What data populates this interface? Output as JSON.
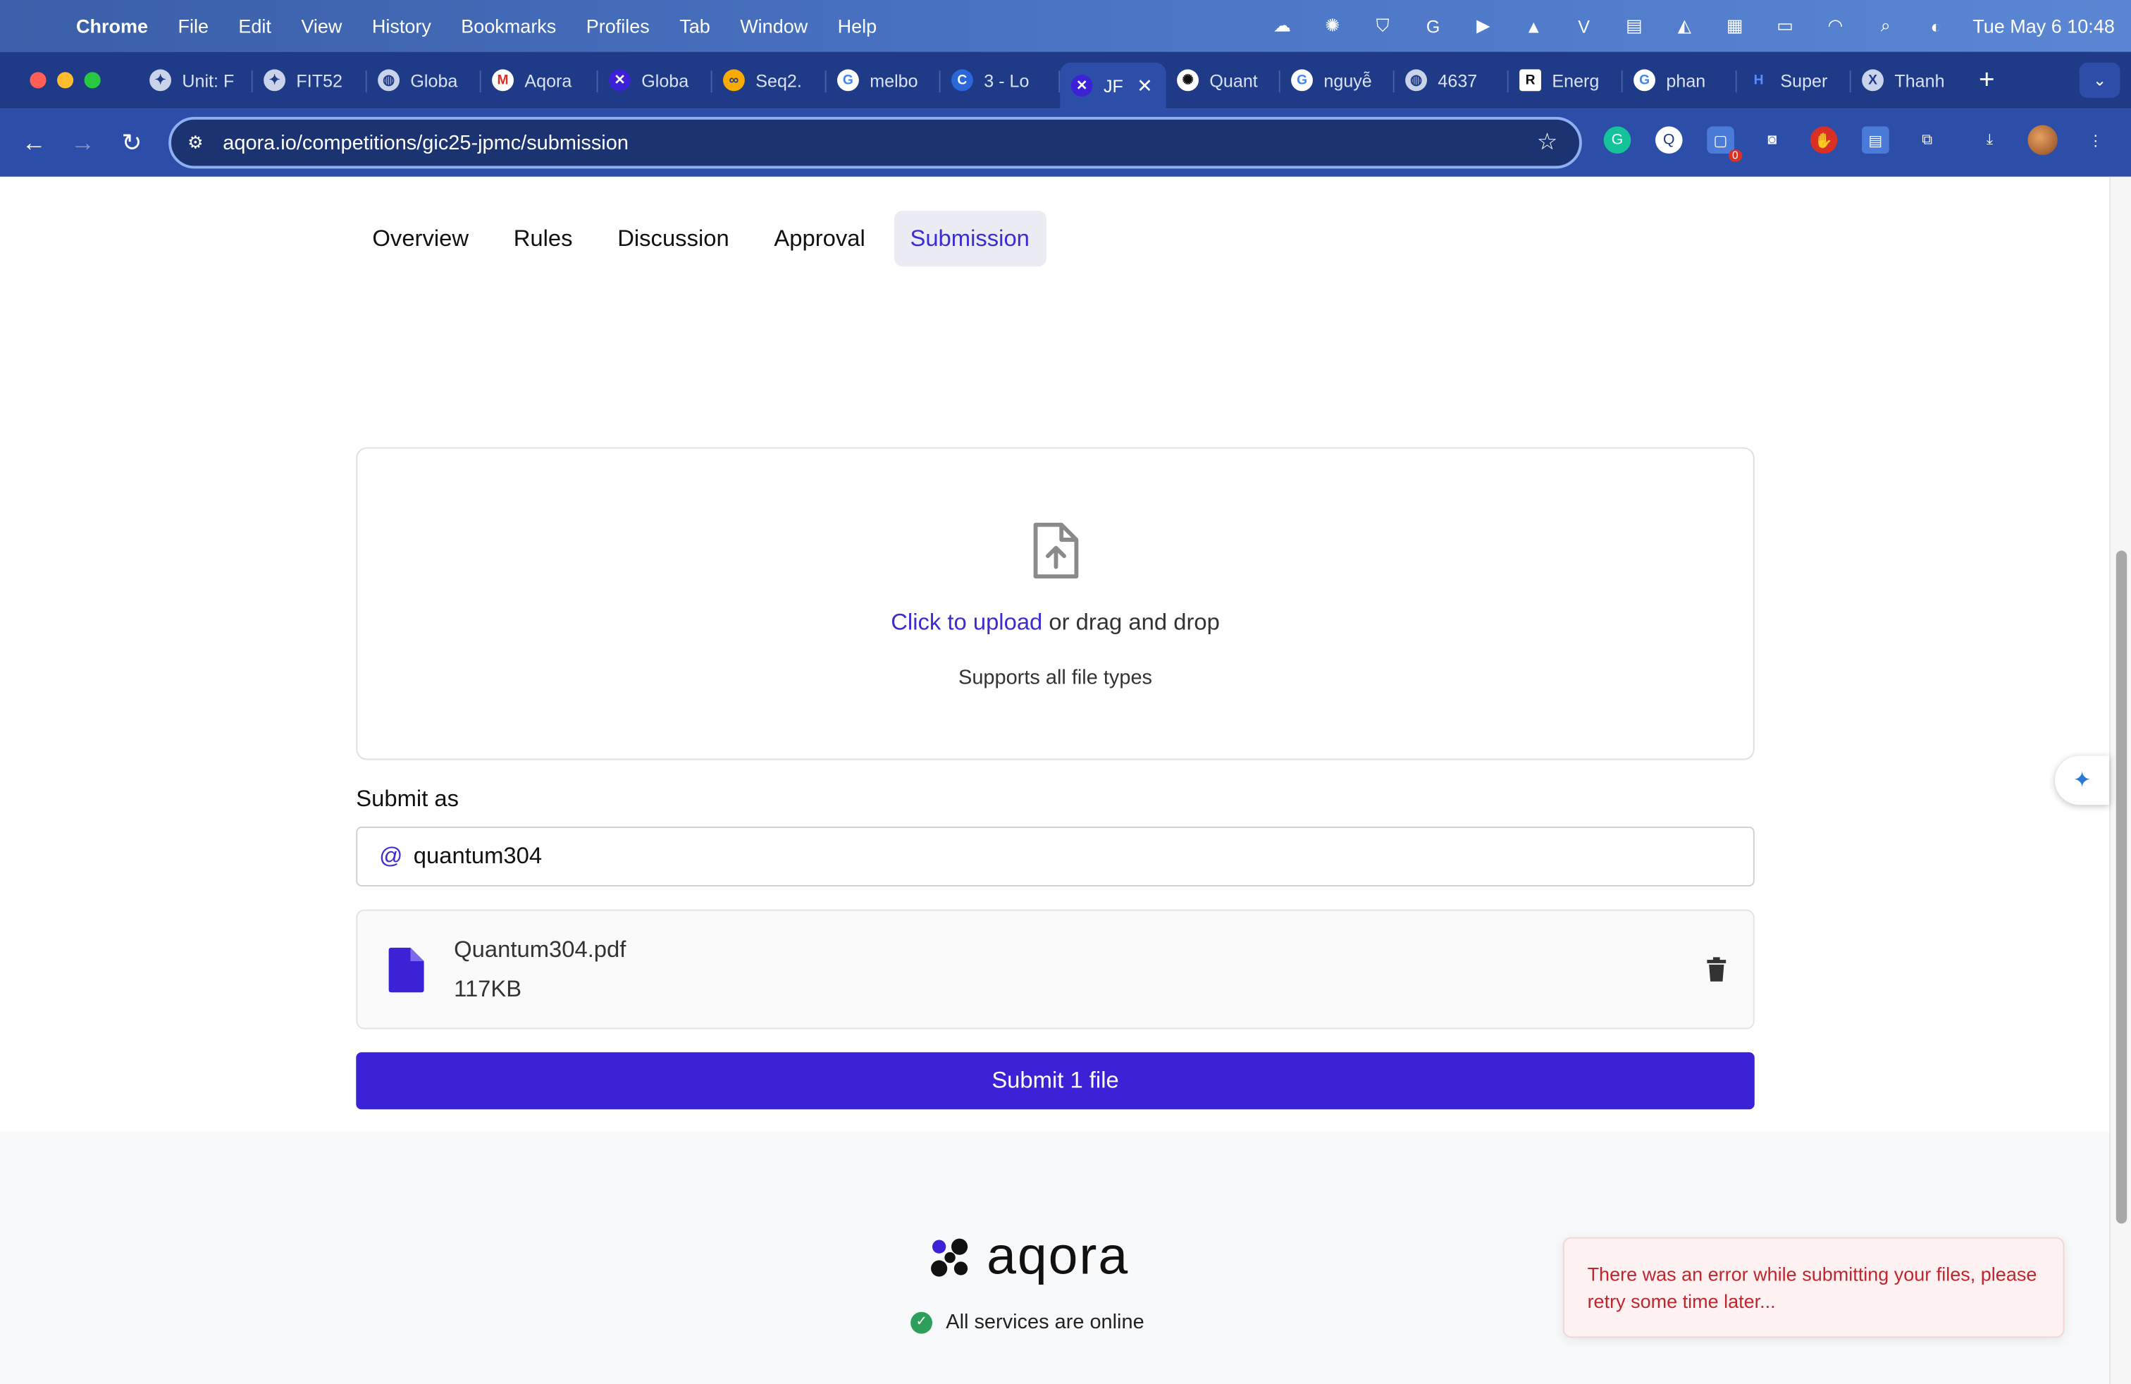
{
  "menubar": {
    "app_name": "Chrome",
    "items": [
      "File",
      "Edit",
      "View",
      "History",
      "Bookmarks",
      "Profiles",
      "Tab",
      "Window",
      "Help"
    ],
    "clock": "Tue May 6  10:48"
  },
  "tabs": [
    {
      "label": "Unit: F",
      "icon": "globe-icon"
    },
    {
      "label": "FIT52",
      "icon": "globe-icon"
    },
    {
      "label": "Globa",
      "icon": "globe-icon"
    },
    {
      "label": "Aqora",
      "icon": "gmail-icon"
    },
    {
      "label": "Globa",
      "icon": "aqora-icon"
    },
    {
      "label": "Seq2.",
      "icon": "colab-icon"
    },
    {
      "label": "melbo",
      "icon": "google-icon"
    },
    {
      "label": "3 - Lo",
      "icon": "globe-icon"
    },
    {
      "label": "JF",
      "icon": "aqora-icon",
      "active": true
    },
    {
      "label": "Quant",
      "icon": "chatgpt-icon"
    },
    {
      "label": "nguyễ",
      "icon": "google-icon"
    },
    {
      "label": "4637",
      "icon": "globe-icon"
    },
    {
      "label": "Energ",
      "icon": "researchgate-icon"
    },
    {
      "label": "phan",
      "icon": "google-icon"
    },
    {
      "label": "Super",
      "icon": "globe-icon"
    },
    {
      "label": "Thanh",
      "icon": "globe-icon"
    }
  ],
  "address_bar": {
    "url": "aqora.io/competitions/gic25-jpmc/submission"
  },
  "extensions": {
    "badge_count": "0"
  },
  "nav_tabs": [
    "Overview",
    "Rules",
    "Discussion",
    "Approval",
    "Submission"
  ],
  "active_nav_tab": "Submission",
  "upload": {
    "link_text": "Click to upload",
    "rest_text": " or drag and drop",
    "supports_text": "Supports all file types"
  },
  "submit_as": {
    "label": "Submit as",
    "prefix": "@",
    "value": "quantum304"
  },
  "file": {
    "name": "Quantum304.pdf",
    "size": "117KB"
  },
  "submit_button": "Submit 1 file",
  "footer": {
    "brand": "aqora",
    "status": "All services are online"
  },
  "toast": {
    "message": "There was an error while submitting your files, please retry some time later..."
  },
  "colors": {
    "accent": "#3b22d6",
    "link": "#3b2dd1",
    "error": "#c0262d",
    "status_ok": "#2e9e5b"
  }
}
